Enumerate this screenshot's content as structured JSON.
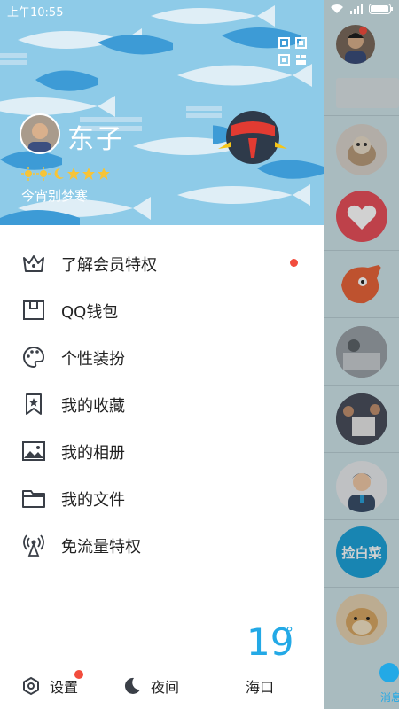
{
  "status_bar": {
    "time": "上午10:55"
  },
  "profile": {
    "nickname": "东子",
    "signature": "今宵别梦寒",
    "level_icons": [
      "sun",
      "sun",
      "moon",
      "star",
      "star",
      "star"
    ]
  },
  "menu": {
    "items": [
      {
        "name": "vip-privileges",
        "label": "了解会员特权",
        "icon": "crown-icon",
        "has_dot": true
      },
      {
        "name": "qq-wallet",
        "label": "QQ钱包",
        "icon": "wallet-icon",
        "has_dot": false
      },
      {
        "name": "personalize",
        "label": "个性装扮",
        "icon": "palette-icon",
        "has_dot": false
      },
      {
        "name": "favorites",
        "label": "我的收藏",
        "icon": "bookmark-star-icon",
        "has_dot": false
      },
      {
        "name": "album",
        "label": "我的相册",
        "icon": "image-icon",
        "has_dot": false
      },
      {
        "name": "files",
        "label": "我的文件",
        "icon": "folder-icon",
        "has_dot": false
      },
      {
        "name": "free-data",
        "label": "免流量特权",
        "icon": "signal-tower-icon",
        "has_dot": false
      }
    ]
  },
  "weather": {
    "temp": "19",
    "unit": "°",
    "city": "海口"
  },
  "bottom_bar": {
    "settings_label": "设置",
    "night_label": "夜间"
  },
  "background_panel": {
    "tab_label": "消息",
    "chip_text": "捡白菜"
  },
  "colors": {
    "accent": "#23a9e6",
    "dot": "#f24c3d",
    "header_bg": "#8ecbe8"
  }
}
